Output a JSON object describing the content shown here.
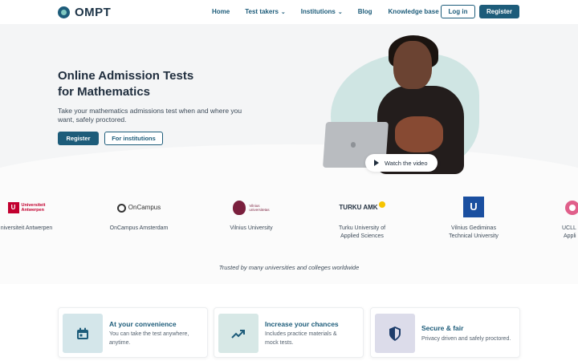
{
  "brand": {
    "name": "OMPT"
  },
  "nav": {
    "links": [
      {
        "label": "Home",
        "chevron": false
      },
      {
        "label": "Test takers",
        "chevron": true
      },
      {
        "label": "Institutions",
        "chevron": true
      },
      {
        "label": "Blog",
        "chevron": false
      },
      {
        "label": "Knowledge base",
        "chevron": false
      }
    ],
    "login_label": "Log in",
    "register_label": "Register"
  },
  "hero": {
    "title_line1": "Online Admission Tests",
    "title_line2": "for Mathematics",
    "subtitle": "Take your mathematics admissions test when and where you want, safely proctored.",
    "register_label": "Register",
    "institutions_label": "For institutions",
    "watch_label": "Watch the video"
  },
  "universities": [
    {
      "name": "niversiteit Antwerpen",
      "logo_text_1": "Universiteit",
      "logo_text_2": "Antwerpen"
    },
    {
      "name": "OnCampus Amsterdam",
      "logo_text": "OnCampus"
    },
    {
      "name": "Vilnius University",
      "logo_text_1": "Vilnius",
      "logo_text_2": "universitetas"
    },
    {
      "name_line1": "Turku University of",
      "name_line2": "Applied Sciences",
      "logo_text": "TURKU AMK"
    },
    {
      "name_line1": "Vilnius Gediminas",
      "name_line2": "Technical University",
      "logo_text": "U"
    },
    {
      "name_line1": "UCLL",
      "name_line2": "Appli"
    }
  ],
  "trusted_text": "Trusted by many universities and colleges worldwide",
  "features": [
    {
      "title": "At your convenience",
      "desc": "You can take the test anywhere, anytime.",
      "icon": "calendar-icon",
      "bg": "#d4e6ea"
    },
    {
      "title": "Increase your chances",
      "desc": "Includes practice materials & mock tests.",
      "icon": "trending-up-icon",
      "bg": "#d7e8e6"
    },
    {
      "title": "Secure & fair",
      "desc": "Privacy driven and safely proctored.",
      "icon": "shield-icon",
      "bg": "#dcdcea"
    }
  ],
  "colors": {
    "primary": "#1d5c7a",
    "accent": "#7fc8c0"
  }
}
